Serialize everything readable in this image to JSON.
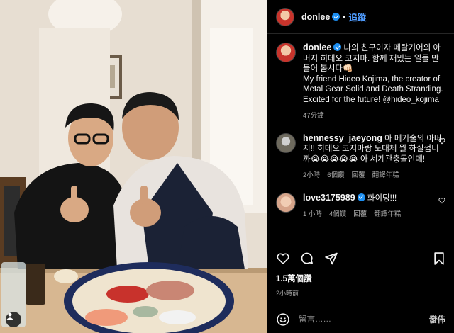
{
  "post": {
    "username": "donlee",
    "follow_label": "追蹤",
    "caption_ko": "나의 친구이자 메탈기어의 아버지 히데오 코지마. 함께 재밌는 일들 만들어 봅시다👊🏻",
    "caption_en": "My friend Hideo Kojima, the creator of Metal Gear Solid and Death Stranding. Excited for the future! @hideo_kojima",
    "caption_age": "47分鐘"
  },
  "comments": [
    {
      "username": "hennessy_jaeyong",
      "text": "아 메기술의 아버지!! 히데오 코지마랑 도대체 뭘 하실껍니까😭😭😭😭😭 아 세계관충돌인데!",
      "age": "2小時",
      "likes": "6個讚",
      "reply": "回覆",
      "translate": "翻譯年糕"
    },
    {
      "username": "love3175989",
      "text": "화이팅!!!",
      "age": "1 小時",
      "likes": "4個讚",
      "reply": "回覆",
      "translate": "翻譯年糕"
    }
  ],
  "actions": {
    "like_count": "1.5萬個讚",
    "posted_time": "2小時前"
  },
  "composer": {
    "placeholder": "留言……",
    "post_label": "發佈"
  },
  "icons": {
    "like": "heart-icon",
    "comment": "comment-icon",
    "share": "share-icon",
    "save": "bookmark-icon",
    "emoji": "emoji-icon",
    "tagged_user": "user-icon",
    "verified": "verified-badge-icon"
  },
  "colors": {
    "background": "#000000",
    "follow_accent": "#4f9cff",
    "verified": "#1d8ff2",
    "muted_text": "#a8a8a8",
    "divider": "#262626"
  }
}
